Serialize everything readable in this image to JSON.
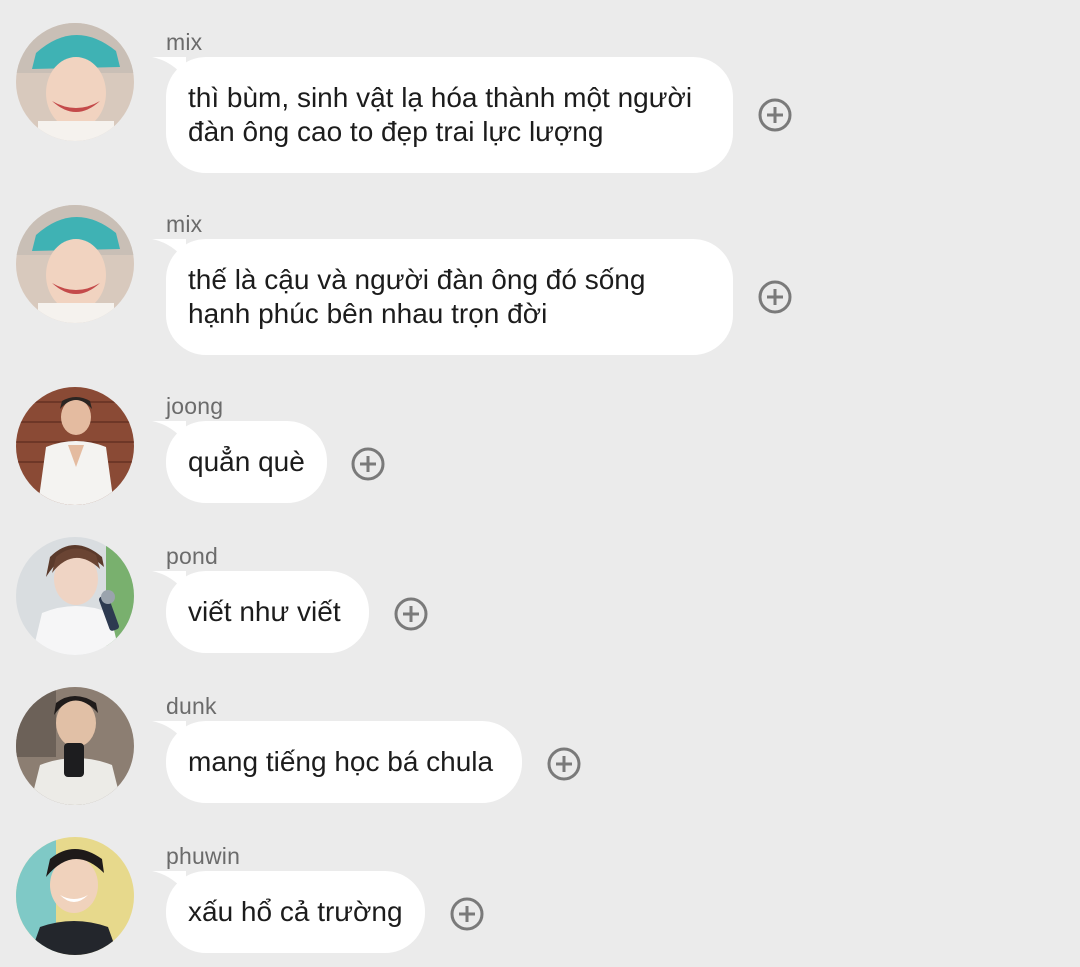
{
  "messages": [
    {
      "sender": "mix",
      "text": "thì bùm, sinh vật lạ hóa thành một người\nđàn ông cao to đẹp trai lực lượng",
      "avatar_icon": "avatar-mix",
      "react_icon": "add-reaction-icon"
    },
    {
      "sender": "mix",
      "text": "thế là cậu và người đàn ông đó sống\nhạnh phúc bên nhau trọn đời",
      "avatar_icon": "avatar-mix",
      "react_icon": "add-reaction-icon"
    },
    {
      "sender": "joong",
      "text": "quẳn què",
      "avatar_icon": "avatar-joong",
      "react_icon": "add-reaction-icon"
    },
    {
      "sender": "pond",
      "text": "viết như viết",
      "avatar_icon": "avatar-pond",
      "react_icon": "add-reaction-icon"
    },
    {
      "sender": "dunk",
      "text": "mang tiếng học bá chula",
      "avatar_icon": "avatar-dunk",
      "react_icon": "add-reaction-icon"
    },
    {
      "sender": "phuwin",
      "text": "xấu hổ cả trường",
      "avatar_icon": "avatar-phuwin",
      "react_icon": "add-reaction-icon"
    }
  ],
  "colors": {
    "background": "#ebebeb",
    "bubble": "#ffffff",
    "sender_text": "#6b6b6b",
    "message_text": "#1c1c1c",
    "react_icon": "#7a7a7a"
  }
}
